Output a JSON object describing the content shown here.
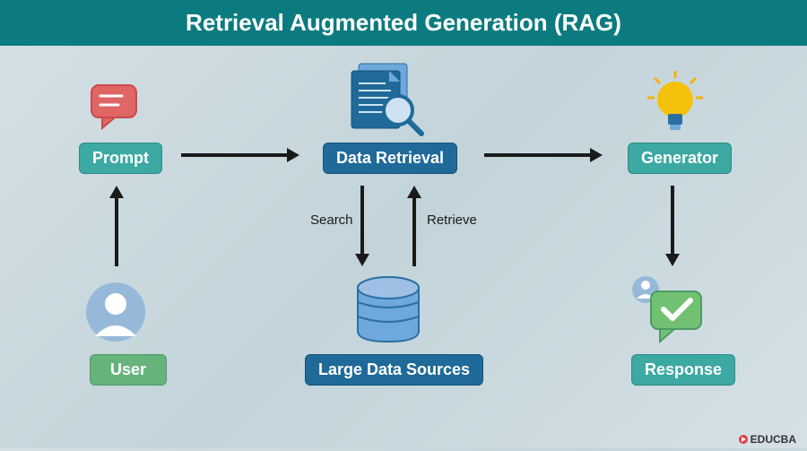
{
  "header": {
    "title": "Retrieval Augmented Generation (RAG)"
  },
  "nodes": {
    "prompt": "Prompt",
    "data_retrieval": "Data Retrieval",
    "generator": "Generator",
    "user": "User",
    "large_data_sources": "Large Data Sources",
    "response": "Response"
  },
  "arrow_labels": {
    "search": "Search",
    "retrieve": "Retrieve"
  },
  "logo": {
    "text": "EDUCBA"
  }
}
